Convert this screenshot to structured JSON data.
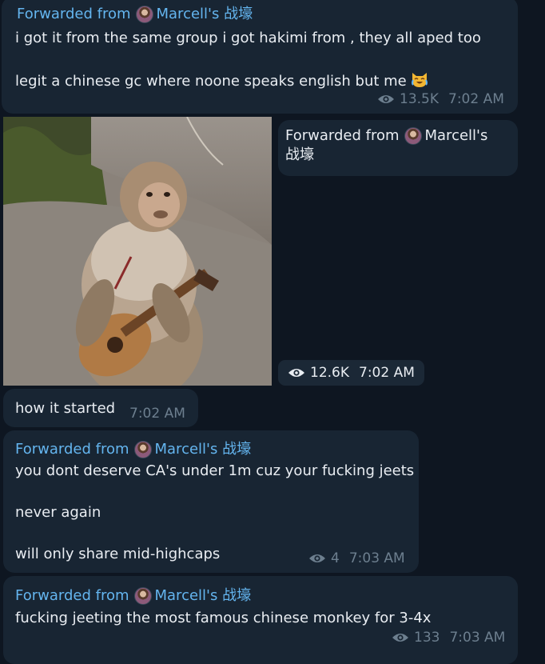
{
  "messages": [
    {
      "forwarded_prefix": "Forwarded from",
      "source": "Marcell's 战壕",
      "lines": [
        "i got it from the same group i got hakimi from , they all aped too",
        "",
        "legit a chinese gc where noone speaks english but me"
      ],
      "emoji": "crying-laughing-cat-emoji",
      "views": "13.5K",
      "time": "7:02 AM"
    },
    {
      "forwarded_prefix": "Forwarded from",
      "source_line1": "Marcell's",
      "source_line2": "战壕",
      "photo": "monkey-playing-ukulele-photo",
      "views": "12.6K",
      "time": "7:02 AM"
    },
    {
      "text": "how it started",
      "time": "7:02 AM"
    },
    {
      "forwarded_prefix": "Forwarded from",
      "source": "Marcell's 战壕",
      "lines": [
        "you dont deserve CA's under 1m cuz your fucking jeets",
        "",
        "never again",
        "",
        "will only share mid-highcaps"
      ],
      "views": "4",
      "time": "7:03 AM"
    },
    {
      "forwarded_prefix": "Forwarded from",
      "source": "Marcell's 战壕",
      "lines": [
        "fucking jeeting the most famous chinese monkey for 3-4x"
      ],
      "views": "133",
      "time": "7:03 AM"
    }
  ],
  "colors": {
    "background": "#0e1621",
    "bubble": "#182533",
    "link": "#64b5ef",
    "meta": "#6d7f8f",
    "text": "#e9edf2"
  }
}
